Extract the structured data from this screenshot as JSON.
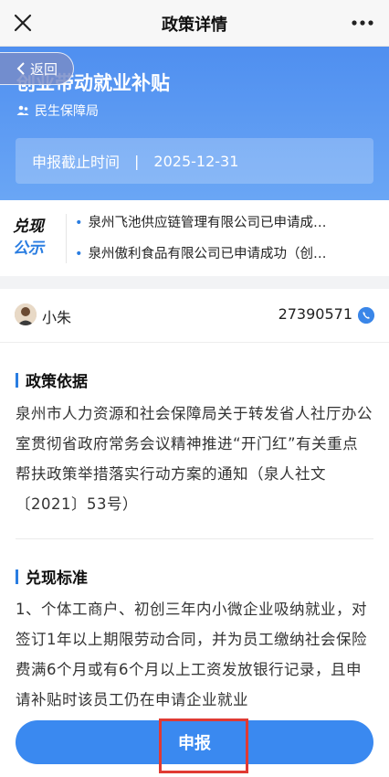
{
  "nav": {
    "title": "政策详情"
  },
  "header": {
    "policy_title": "创业带动就业补贴",
    "back_label": "返回",
    "department": "民生保障局",
    "deadline_label": "申报截止时间",
    "deadline_sep": "|",
    "deadline_value": "2025-12-31"
  },
  "notice": {
    "logo_line1": "兑现",
    "logo_line2": "公示",
    "items": [
      "泉州飞池供应链管理有限公司已申请成…",
      "泉州傲利食品有限公司已申请成功（创…"
    ]
  },
  "contact": {
    "name": "小朱",
    "phone": "27390571"
  },
  "sections": [
    {
      "title": "政策依据",
      "body": "泉州市人力资源和社会保障局关于转发省人社厅办公室贯彻省政府常务会议精神推进“开门红”有关重点帮扶政策举措落实行动方案的通知（泉人社文〔2021〕53号）"
    },
    {
      "title": "兑现标准",
      "body": "1、个体工商户、初创三年内小微企业吸纳就业，对签订1年以上期限劳动合同，并为员工缴纳社会保险费满6个月或有6个月以上工资发放银行记录，且申请补贴时该员工仍在申请企业就业"
    }
  ],
  "bottom": {
    "apply_label": "申报"
  },
  "colors": {
    "accent": "#2a7de1",
    "header_bg": "#5b98f2",
    "highlight": "#e03a33"
  },
  "icons": [
    "close-icon",
    "more-icon",
    "chevron-left-icon",
    "people-icon",
    "phone-icon"
  ]
}
